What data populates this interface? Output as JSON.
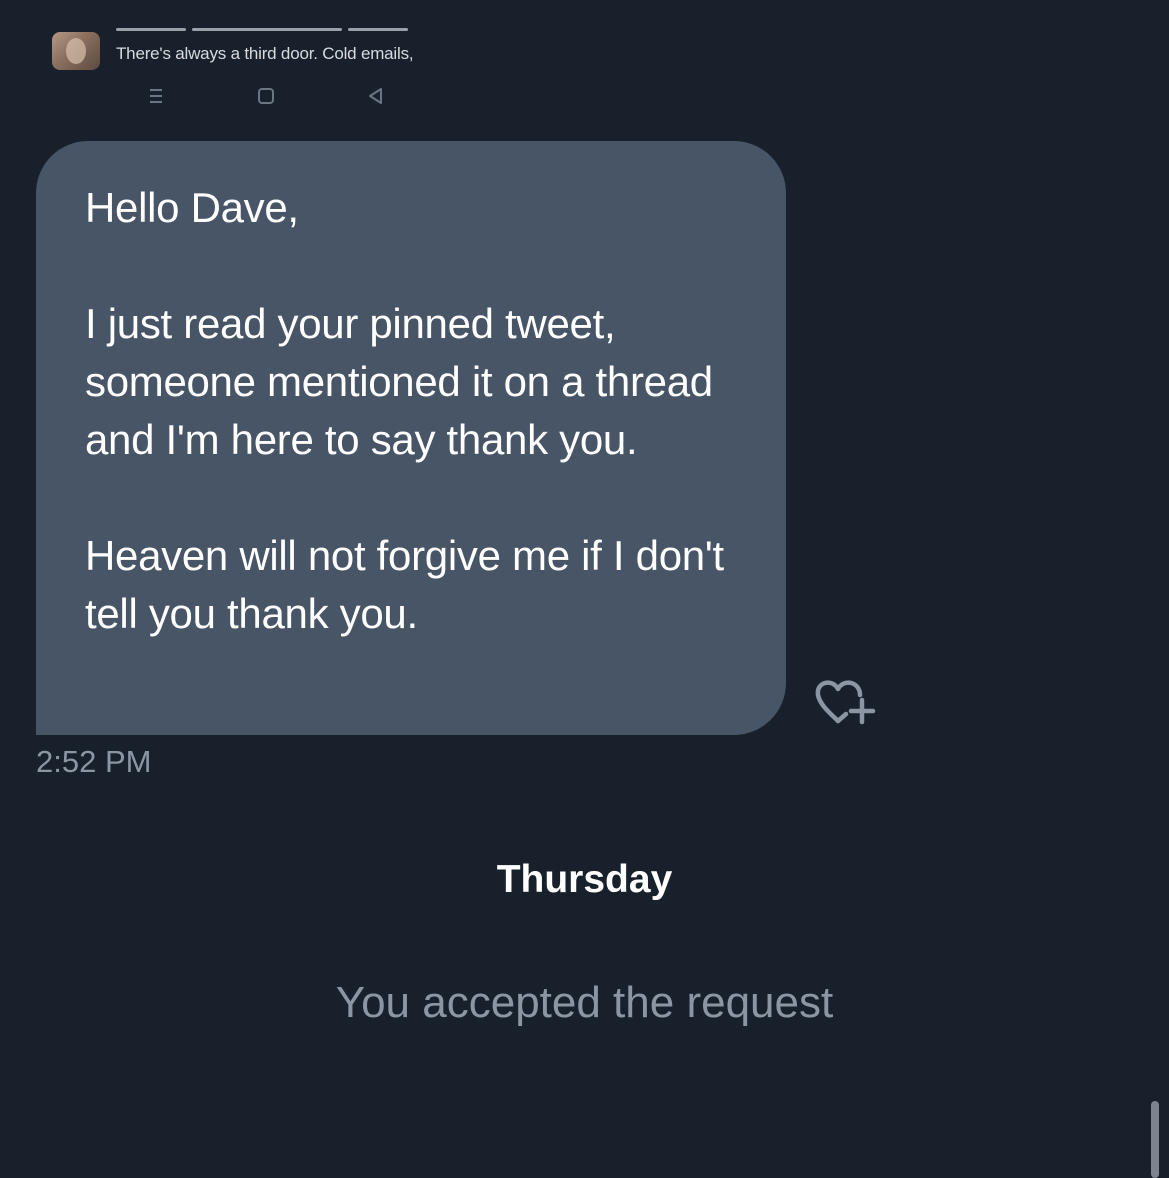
{
  "embedded_preview": {
    "bio_text": "There's always a third door. Cold emails,",
    "nav_icons": [
      "menu-icon",
      "home-square-icon",
      "back-triangle-icon"
    ]
  },
  "message": {
    "greeting": "Hello Dave,",
    "paragraph_1": "I just read your pinned tweet, someone mentioned it on a thread and I'm here to say thank you.",
    "paragraph_2": "Heaven will not forgive me if I don't tell you thank you.",
    "timestamp": "2:52 PM",
    "bubble_color": "#475566"
  },
  "reaction": {
    "icon": "heart-plus-icon"
  },
  "divider": {
    "day_label": "Thursday"
  },
  "system": {
    "status_text": "You accepted the request"
  },
  "colors": {
    "background": "#18202b",
    "text_primary": "#ffffff",
    "text_secondary": "#8b96a2"
  }
}
